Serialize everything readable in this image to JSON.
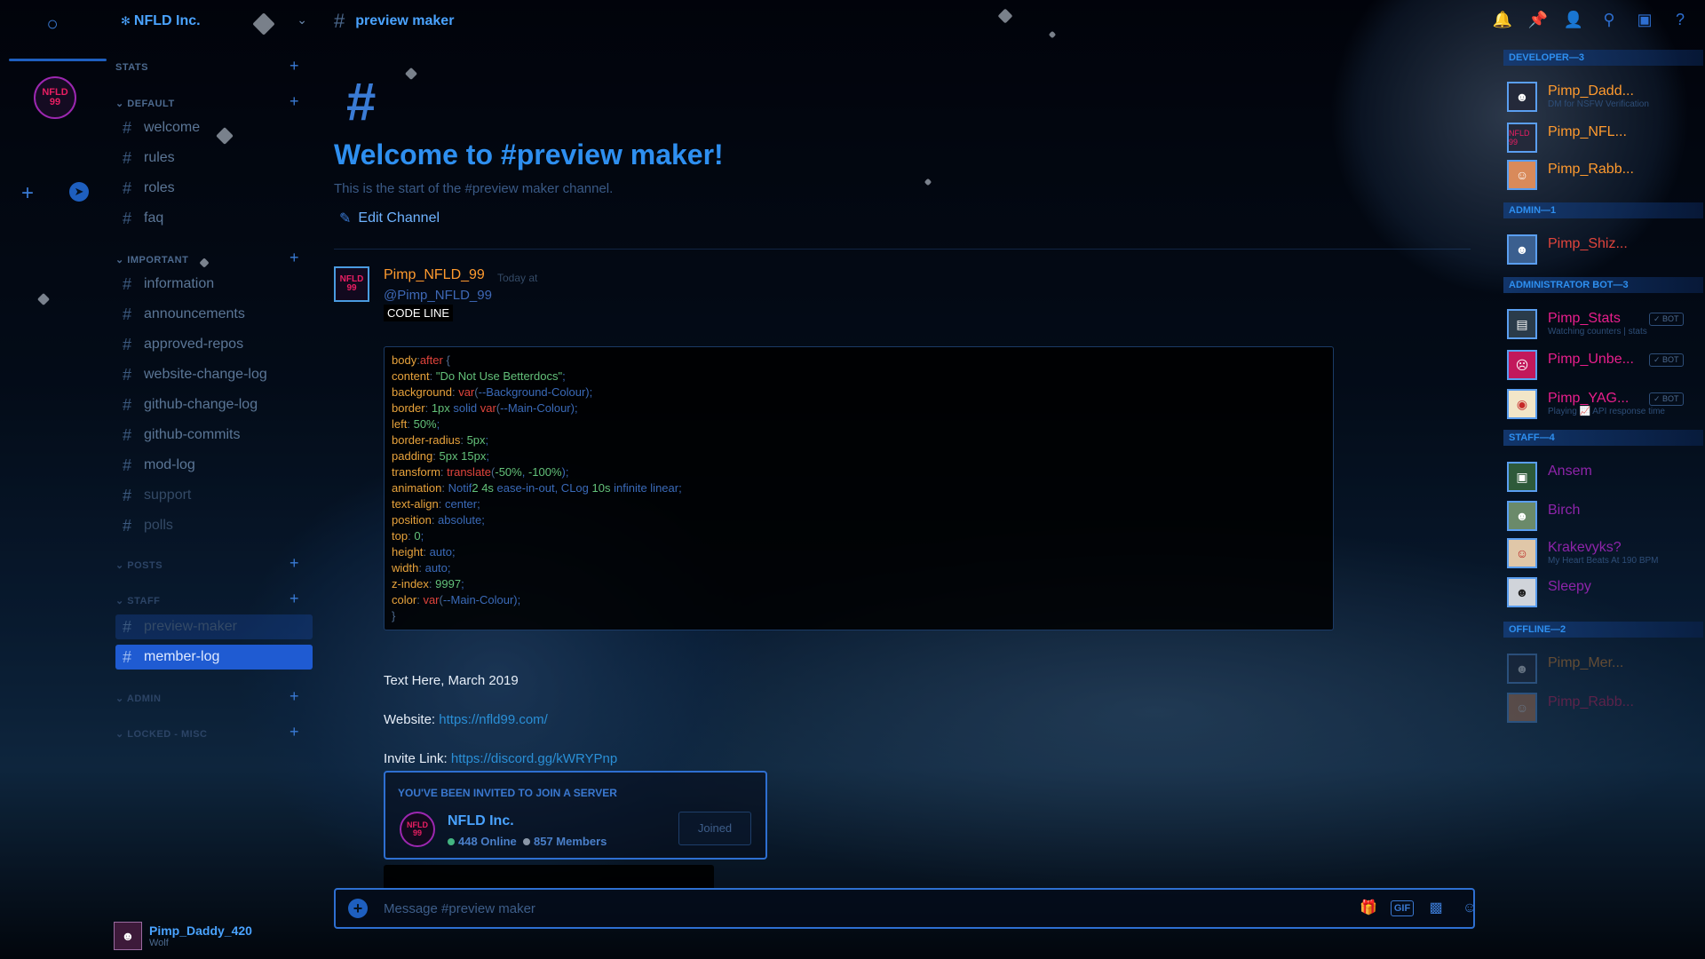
{
  "rail": {
    "server_initials": "NFLD 99",
    "add_label": "+"
  },
  "sidebar": {
    "guild_name": "NFLD Inc.",
    "categories": [
      {
        "label": "STATS"
      },
      {
        "label": "DEFAULT"
      },
      {
        "label": "IMPORTANT"
      },
      {
        "label": "POSTS"
      },
      {
        "label": "STAFF"
      },
      {
        "label": "ADMIN"
      },
      {
        "label": "LOCKED - MISC"
      }
    ],
    "channels": [
      {
        "label": "welcome"
      },
      {
        "label": "rules"
      },
      {
        "label": "roles"
      },
      {
        "label": "faq"
      },
      {
        "label": "information"
      },
      {
        "label": "announcements"
      },
      {
        "label": "approved-repos"
      },
      {
        "label": "website-change-log"
      },
      {
        "label": "github-change-log"
      },
      {
        "label": "github-commits"
      },
      {
        "label": "mod-log"
      },
      {
        "label": "support"
      },
      {
        "label": "polls"
      },
      {
        "label": "preview-maker"
      },
      {
        "label": "member-log"
      }
    ],
    "user": {
      "name": "Pimp_Daddy_420",
      "status": "Wolf"
    }
  },
  "chat": {
    "channel": "preview maker",
    "welcome_title": "Welcome to #preview maker!",
    "welcome_sub": "This is the start of the #preview maker channel.",
    "edit_channel": "Edit Channel",
    "message": {
      "author": "Pimp_NFLD_99",
      "timestamp": "Today at",
      "mention": "@Pimp_NFLD_99",
      "code_label": "CODE LINE",
      "code": [
        "body:after {",
        "content: \"Do Not Use Betterdocs\";",
        "background: var(--Background-Colour);",
        "border: 1px solid var(--Main-Colour);",
        "left: 50%;",
        "border-radius: 5px;",
        "padding: 5px 15px;",
        "transform: translate(-50%, -100%);",
        "animation: Notif2 4s ease-in-out, CLog 10s infinite linear;",
        "text-align: center;",
        "position: absolute;",
        "top: 0;",
        "height: auto;",
        "width: auto;",
        "z-index: 9997;",
        "color: var(--Main-Colour);",
        "}"
      ],
      "text_date": "Text Here, March 2019",
      "website_label": "Website:",
      "website_url": "https://nfld99.com/",
      "invite_label": "Invite Link:",
      "invite_url": "https://discord.gg/kWRYPnp"
    },
    "invite": {
      "heading": "YOU'VE BEEN INVITED TO JOIN A SERVER",
      "server": "NFLD Inc.",
      "online": "448 Online",
      "members": "857 Members",
      "join": "Joined"
    },
    "input_placeholder": "Message #preview maker",
    "input_gif": "GIF"
  },
  "members": {
    "groups": [
      {
        "label": "DEVELOPER—3"
      },
      {
        "label": "ADMIN—1"
      },
      {
        "label": "ADMINISTRATOR BOT—3"
      },
      {
        "label": "STAFF—4"
      },
      {
        "label": "OFFLINE—2"
      }
    ],
    "list": [
      {
        "name": "Pimp_Dadd...",
        "sub": "DM for NSFW Verification",
        "color": "#ff9a2e"
      },
      {
        "name": "Pimp_NFL...",
        "sub": "",
        "color": "#ff9a2e"
      },
      {
        "name": "Pimp_Rabb...",
        "sub": "",
        "color": "#ff9a2e"
      },
      {
        "name": "Pimp_Shiz...",
        "sub": "",
        "color": "#e0443c"
      },
      {
        "name": "Pimp_Stats",
        "sub": "Watching counters | stats",
        "color": "#e91e8c",
        "bot": "✓ BOT"
      },
      {
        "name": "Pimp_Unbe...",
        "sub": "",
        "color": "#e91e8c",
        "bot": "✓ BOT"
      },
      {
        "name": "Pimp_YAG...",
        "sub": "Playing 📈 API response time",
        "color": "#e91e8c",
        "bot": "✓ BOT"
      },
      {
        "name": "Ansem",
        "sub": "",
        "color": "#8e24aa"
      },
      {
        "name": "Birch",
        "sub": "",
        "color": "#8e24aa"
      },
      {
        "name": "Krakevyks?",
        "sub": "My Heart Beats At 190 BPM",
        "color": "#8e24aa"
      },
      {
        "name": "Sleepy",
        "sub": "",
        "color": "#8e24aa"
      },
      {
        "name": "Pimp_Mer...",
        "sub": "",
        "color": "#ff9a2e"
      },
      {
        "name": "Pimp_Rabb...",
        "sub": "",
        "color": "#e91e63"
      }
    ]
  },
  "colors": {
    "accent": "#1f5bd2",
    "link": "#2a8fd6",
    "online": "#43b581"
  }
}
